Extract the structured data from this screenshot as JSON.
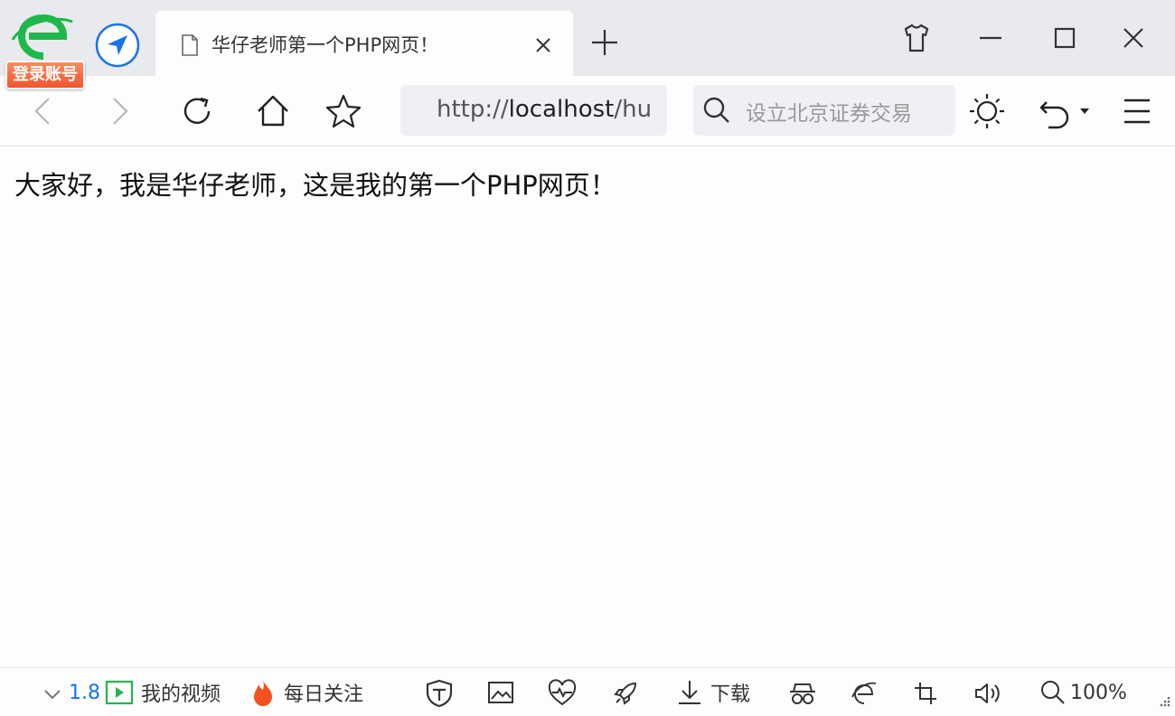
{
  "tab": {
    "title": "华仔老师第一个PHP网页！"
  },
  "logo": {
    "badge": "登录账号"
  },
  "address": {
    "prefix": "http://",
    "host": "localhost",
    "rest": "/hu"
  },
  "search": {
    "placeholder": "设立北京证券交易"
  },
  "content": {
    "message": "大家好，我是华仔老师，这是我的第一个PHP网页！"
  },
  "status": {
    "speed": "1.8",
    "my_video": "我的视频",
    "daily_follow": "每日关注",
    "download": "下载",
    "zoom": "100%"
  },
  "colors": {
    "accent_green": "#1fb84a",
    "accent_blue": "#1a73e8",
    "badge_orange": "#f2542f",
    "flame": "#f4511e"
  }
}
